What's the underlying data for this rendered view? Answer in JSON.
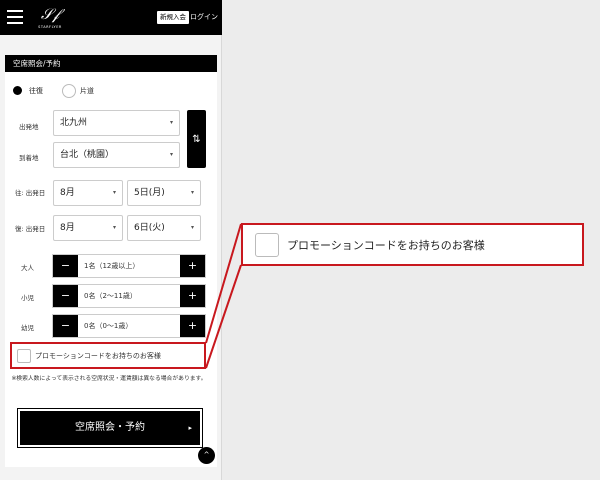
{
  "header": {
    "menu_icon": "hamburger-icon",
    "logo_mark": "𝒮𝒻",
    "logo_text": "STARFLYER",
    "register_label": "新規入会",
    "login_label": "ログイン"
  },
  "form": {
    "title": "空席照会/予約",
    "trip_types": [
      {
        "label": "往復",
        "checked": true
      },
      {
        "label": "片道",
        "checked": false
      }
    ],
    "departure_label": "出発地",
    "departure_value": "北九州",
    "arrival_label": "到着地",
    "arrival_value": "台北（桃園）",
    "swap_icon": "swap-arrows-icon",
    "outbound_label": "往: 出発日",
    "outbound_month": "8月",
    "outbound_day": "5日(月)",
    "return_label": "復: 出発日",
    "return_month": "8月",
    "return_day": "6日(火)",
    "passengers": [
      {
        "label": "大人",
        "value": "1名（12歳以上）"
      },
      {
        "label": "小児",
        "value": "0名（2〜11歳）"
      },
      {
        "label": "幼児",
        "value": "0名（0〜1歳）"
      }
    ],
    "minus": "−",
    "plus": "+",
    "promo_label": "プロモーションコードをお持ちのお客様",
    "note": "※検索人数によって表示される空席状況・運賃額は異なる場合があります。",
    "search_label": "空席照会・予約",
    "search_arrow": "▸",
    "scroll_top_icon": "^"
  },
  "zoom": {
    "promo_label": "プロモーションコードをお持ちのお客様",
    "highlight_color": "#c8181e"
  }
}
